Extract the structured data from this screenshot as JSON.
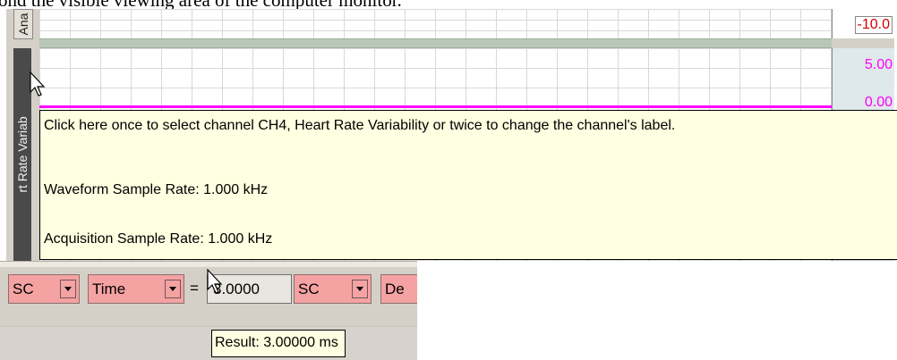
{
  "document_text": "ond the visible viewing area of the computer monitor.",
  "channels": {
    "ch3_label": "Ana",
    "ch4_label": "rt Rate Variab",
    "scale_top_value": "-10.0",
    "scale_values": [
      "5.00",
      "0.00"
    ]
  },
  "tooltip": {
    "line1": "Click here once to select channel CH4, Heart Rate Variability or twice to change the channel's label.",
    "line2": "Waveform Sample Rate: 1.000 kHz",
    "line3": "Acquisition Sample Rate: 1.000 kHz"
  },
  "measurement": {
    "channel1": "SC",
    "type": "Time",
    "equals": "=",
    "value": "3.0000",
    "channel2": "SC",
    "next_type": "De",
    "result_tooltip": "Result:  3.00000 ms"
  },
  "colors": {
    "trace": "#ff00ff",
    "selector_bg": "#f4a2a2",
    "tooltip_bg": "#ffffe1"
  }
}
